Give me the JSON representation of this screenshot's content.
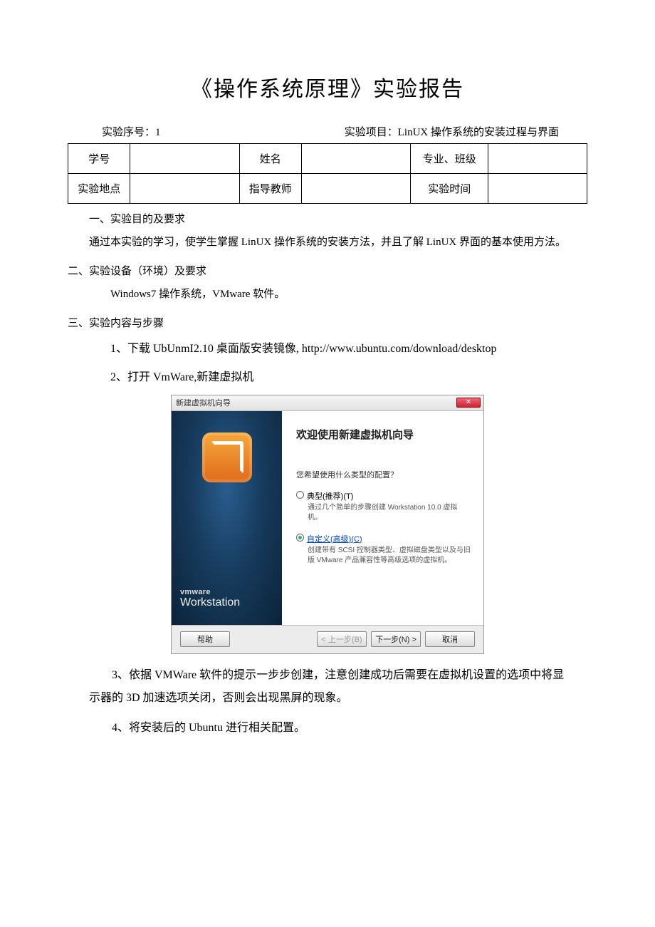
{
  "title": "《操作系统原理》实验报告",
  "meta": {
    "seq_label": "实验序号：1",
    "proj_label": "实验项目：LinUX 操作系统的安装过程与界面"
  },
  "table": {
    "r1c1": "学号",
    "r1c3": "姓名",
    "r1c5": "专业、班级",
    "r2c1": "实验地点",
    "r2c3": "指导教师",
    "r2c5": "实验时间"
  },
  "sec1_h": "一、实验目的及要求",
  "sec1_p": "通过本实验的学习，使学生掌握 LinUX 操作系统的安装方法，并且了解 LinUX 界面的基本使用方法。",
  "sec2_h": "二、实验设备（环境）及要求",
  "sec2_p": "Windows7 操作系统，VMware 软件。",
  "sec3_h": "三、实验内容与步骤",
  "step1": "1、下载 UbUnmI2.10 桌面版安装镜像, http://www.ubuntu.com/download/desktop",
  "step2": "2、打开 VmWare,新建虚拟机",
  "step3": "3、依据 VMWare 软件的提示一步步创建，注意创建成功后需要在虚拟机设置的选项中将显示器的 3D 加速选项关闭，否则会出现黑屏的现象。",
  "step4": "4、将安装后的 Ubuntu 进行相关配置。",
  "wizard": {
    "winTitle": "新建虚拟机向导",
    "brand1": "vmware",
    "brand2": "Workstation",
    "heading": "欢迎使用新建虚拟机向导",
    "question": "您希望使用什么类型的配置？",
    "opt1_label": "典型(推荐)(T)",
    "opt1_desc": "通过几个简单的步骤创建 Workstation 10.0 虚拟机。",
    "opt2_label": "自定义(高级)(C)",
    "opt2_desc": "创建带有 SCSI 控制器类型、虚拟磁盘类型以及与旧版 VMware 产品兼容性等高级选项的虚拟机。",
    "btn_help": "帮助",
    "btn_back": "< 上一步(B)",
    "btn_next": "下一步(N) >",
    "btn_cancel": "取消"
  }
}
